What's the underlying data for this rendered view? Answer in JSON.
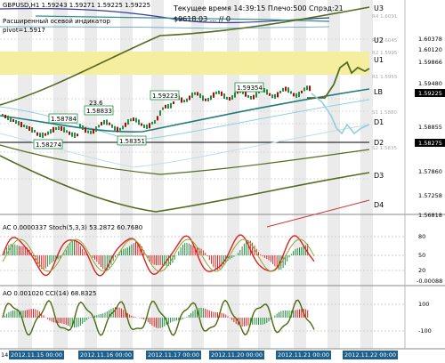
{
  "header": {
    "symbol_line": "GBPUSD,H1  1.59243 1.59271 1.59225 1.59225",
    "subtitle": "Расширенный осевой индикатор",
    "pivot": "pivot=1.5917",
    "server_time": "Текущее время 14:39:15 Плечо:500 Спрэд:21",
    "value_line": "$9618.03    ... // 0"
  },
  "levels": [
    {
      "label": "U3",
      "price": 1.6082
    },
    {
      "label": "U2",
      "price": 1.6035
    },
    {
      "label": "U1",
      "price": 1.5983
    },
    {
      "label": "LB",
      "price": 1.5927
    },
    {
      "label": "D1",
      "price": 1.5886
    },
    {
      "label": "D2",
      "price": 1.5855
    },
    {
      "label": "D3",
      "price": 1.5775
    },
    {
      "label": "D4",
      "price": 1.572
    }
  ],
  "price_axis": [
    "1.60378",
    "1.60120",
    "1.59866",
    "1.59480",
    "1.59225",
    "1.58855",
    "1.58275",
    "1.57860",
    "1.57258",
    "1.56818"
  ],
  "faint_levels": [
    "R4 1.6091",
    "R3 1.6045",
    "R2 1.5995",
    "R1 1.5955",
    "S1 1.5880",
    "S2 1.5835"
  ],
  "chart_labels": [
    {
      "text": "1.59223"
    },
    {
      "text": "1.59354"
    },
    {
      "text": "1.58784"
    },
    {
      "text": "23.6"
    },
    {
      "text": "1.58833"
    },
    {
      "text": "1.58274"
    },
    {
      "text": "1.58351"
    }
  ],
  "ac_stoch": {
    "label": "AC 0.0000337  Stoch(5,3,3) 53.2872 60.7680",
    "axis": [
      "80",
      "50",
      "20",
      "-0.00088"
    ]
  },
  "ao_cci": {
    "label": "AO 0.001020  CCI(14) 68.8325",
    "axis": [
      "100",
      "-100"
    ]
  },
  "time_axis": [
    "14",
    "2012.11.15 00:00",
    "2012.11.16 00:00",
    "2012.11.17 00:00",
    "2012.11.20 00:00",
    "2012.11.21 00:00",
    "2012.11.22 00:00"
  ],
  "colors": {
    "background": "#ffffff",
    "bull": "#1f8f3f",
    "bear": "#c00000",
    "axis_tag": "#000000",
    "zone": "#f5ee9f"
  }
}
